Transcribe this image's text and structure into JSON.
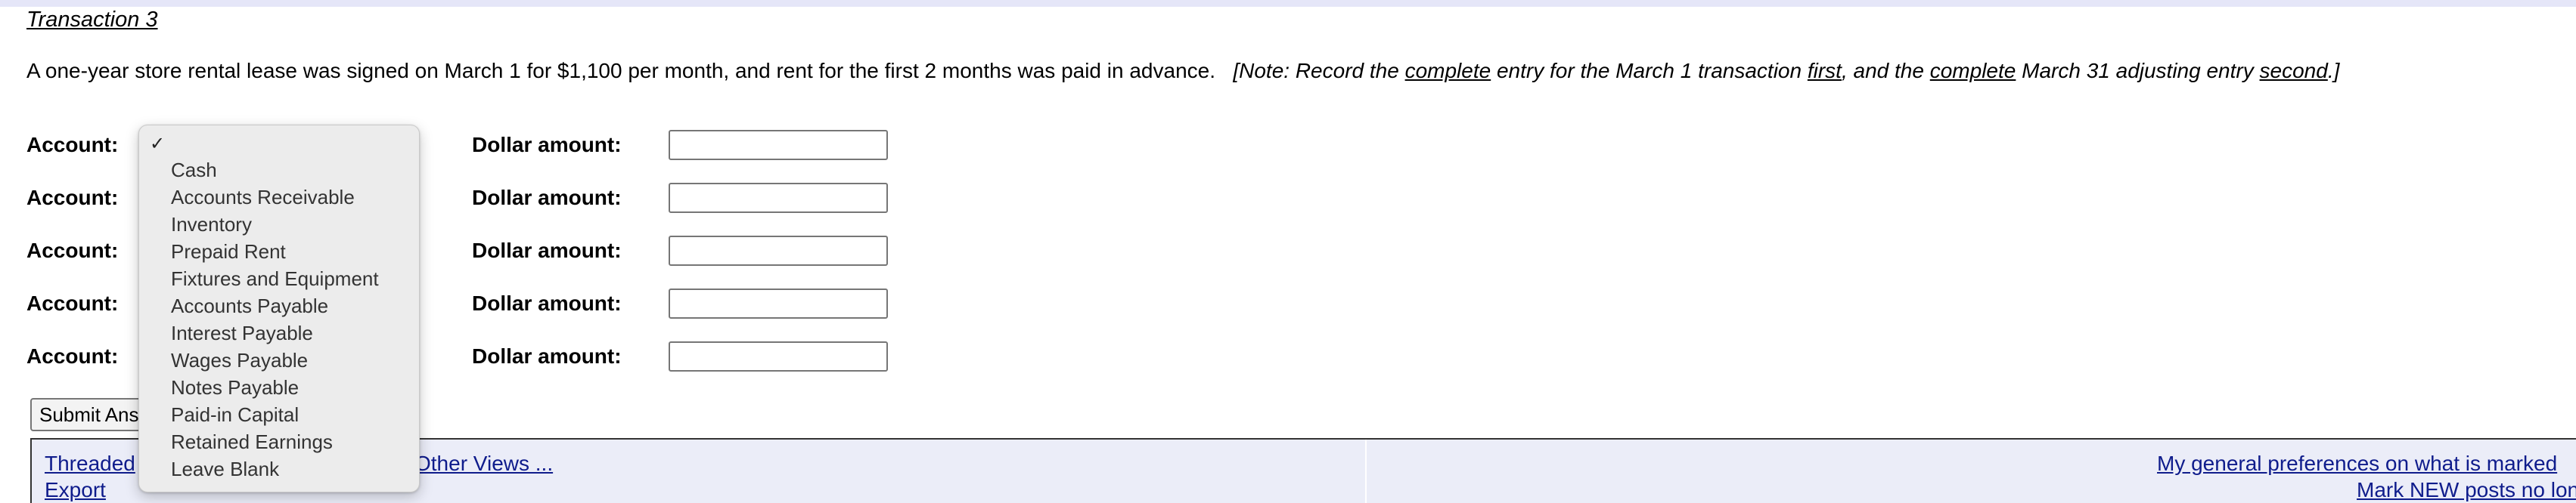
{
  "transaction": {
    "title": "Transaction 3"
  },
  "question": {
    "text": "A one-year store rental lease was signed on March 1 for $1,100 per month, and rent for the first 2 months was paid in advance.",
    "note_open": "[Note: Record the ",
    "note_complete_1": "complete",
    "note_mid_1": " entry for the March 1 transaction ",
    "note_first": "first",
    "note_mid_2": ", and the ",
    "note_complete_2": "complete",
    "note_mid_3": " March 31 adjusting entry ",
    "note_second": "second",
    "note_close": ".]"
  },
  "rows": [
    {
      "account_label": "Account:",
      "amount_label": "Dollar amount:",
      "amount_value": ""
    },
    {
      "account_label": "Account:",
      "amount_label": "Dollar amount:",
      "amount_value": ""
    },
    {
      "account_label": "Account:",
      "amount_label": "Dollar amount:",
      "amount_value": ""
    },
    {
      "account_label": "Account:",
      "amount_label": "Dollar amount:",
      "amount_value": ""
    },
    {
      "account_label": "Account:",
      "amount_label": "Dollar amount:",
      "amount_value": ""
    }
  ],
  "dropdown": {
    "selected_mark": "✓",
    "options": [
      "Cash",
      "Accounts Receivable",
      "Inventory",
      "Prepaid Rent",
      "Fixtures and Equipment",
      "Accounts Payable",
      "Interest Payable",
      "Wages Payable",
      "Notes Payable",
      "Paid-in Capital",
      "Retained Earnings",
      "Leave Blank"
    ]
  },
  "submit": {
    "label": "Submit Answer"
  },
  "footer": {
    "threaded_link": "Threaded",
    "export_link": "Export",
    "other_views_link": "Other Views ...",
    "preferences_link": "My general preferences on what is marked",
    "mark_new_link": "Mark NEW posts no longer new"
  }
}
